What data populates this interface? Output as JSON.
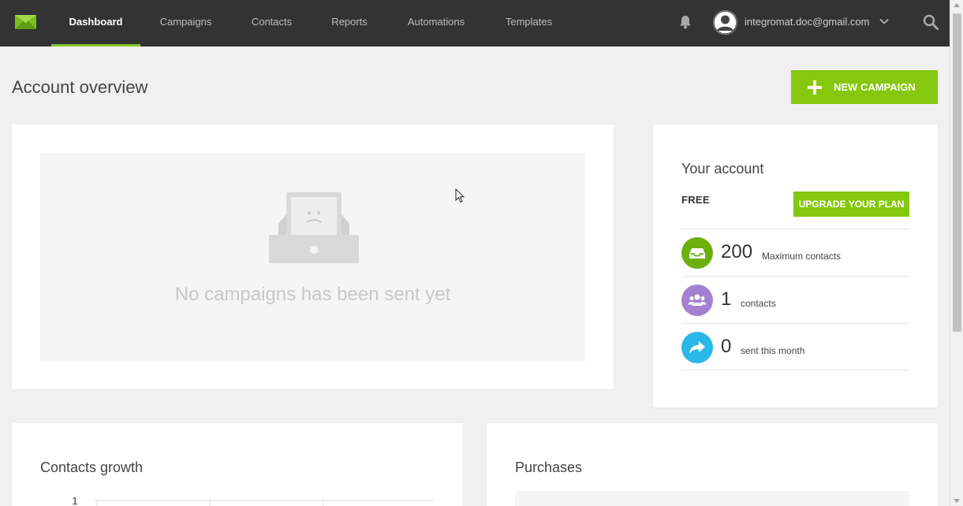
{
  "nav": {
    "items": [
      {
        "label": "Dashboard",
        "active": true
      },
      {
        "label": "Campaigns",
        "active": false
      },
      {
        "label": "Contacts",
        "active": false
      },
      {
        "label": "Reports",
        "active": false
      },
      {
        "label": "Automations",
        "active": false
      },
      {
        "label": "Templates",
        "active": false
      }
    ],
    "user_email": "integromat.doc@gmail.com",
    "icons": [
      "envelope-logo-icon",
      "bell-icon",
      "avatar-icon",
      "chevron-down-icon",
      "search-icon"
    ]
  },
  "page": {
    "title": "Account overview",
    "new_campaign_label": "NEW CAMPAIGN"
  },
  "campaigns": {
    "empty_text": "No campaigns has been sent yet"
  },
  "account": {
    "title": "Your account",
    "plan": "FREE",
    "upgrade_label": "UPGRADE YOUR PLAN",
    "stats": [
      {
        "value": "200",
        "label": "Maximum contacts",
        "icon": "inbox-icon",
        "color": "#6cb00e"
      },
      {
        "value": "1",
        "label": "contacts",
        "icon": "users-icon",
        "color": "#a481d0"
      },
      {
        "value": "0",
        "label": "sent this month",
        "icon": "share-arrow-icon",
        "color": "#2ab8e8"
      }
    ]
  },
  "growth": {
    "title": "Contacts growth",
    "y_tick": "1"
  },
  "purchases": {
    "title": "Purchases"
  },
  "colors": {
    "topbar": "#333333",
    "accent_green": "#85c80d",
    "active_underline": "#85c52f"
  }
}
